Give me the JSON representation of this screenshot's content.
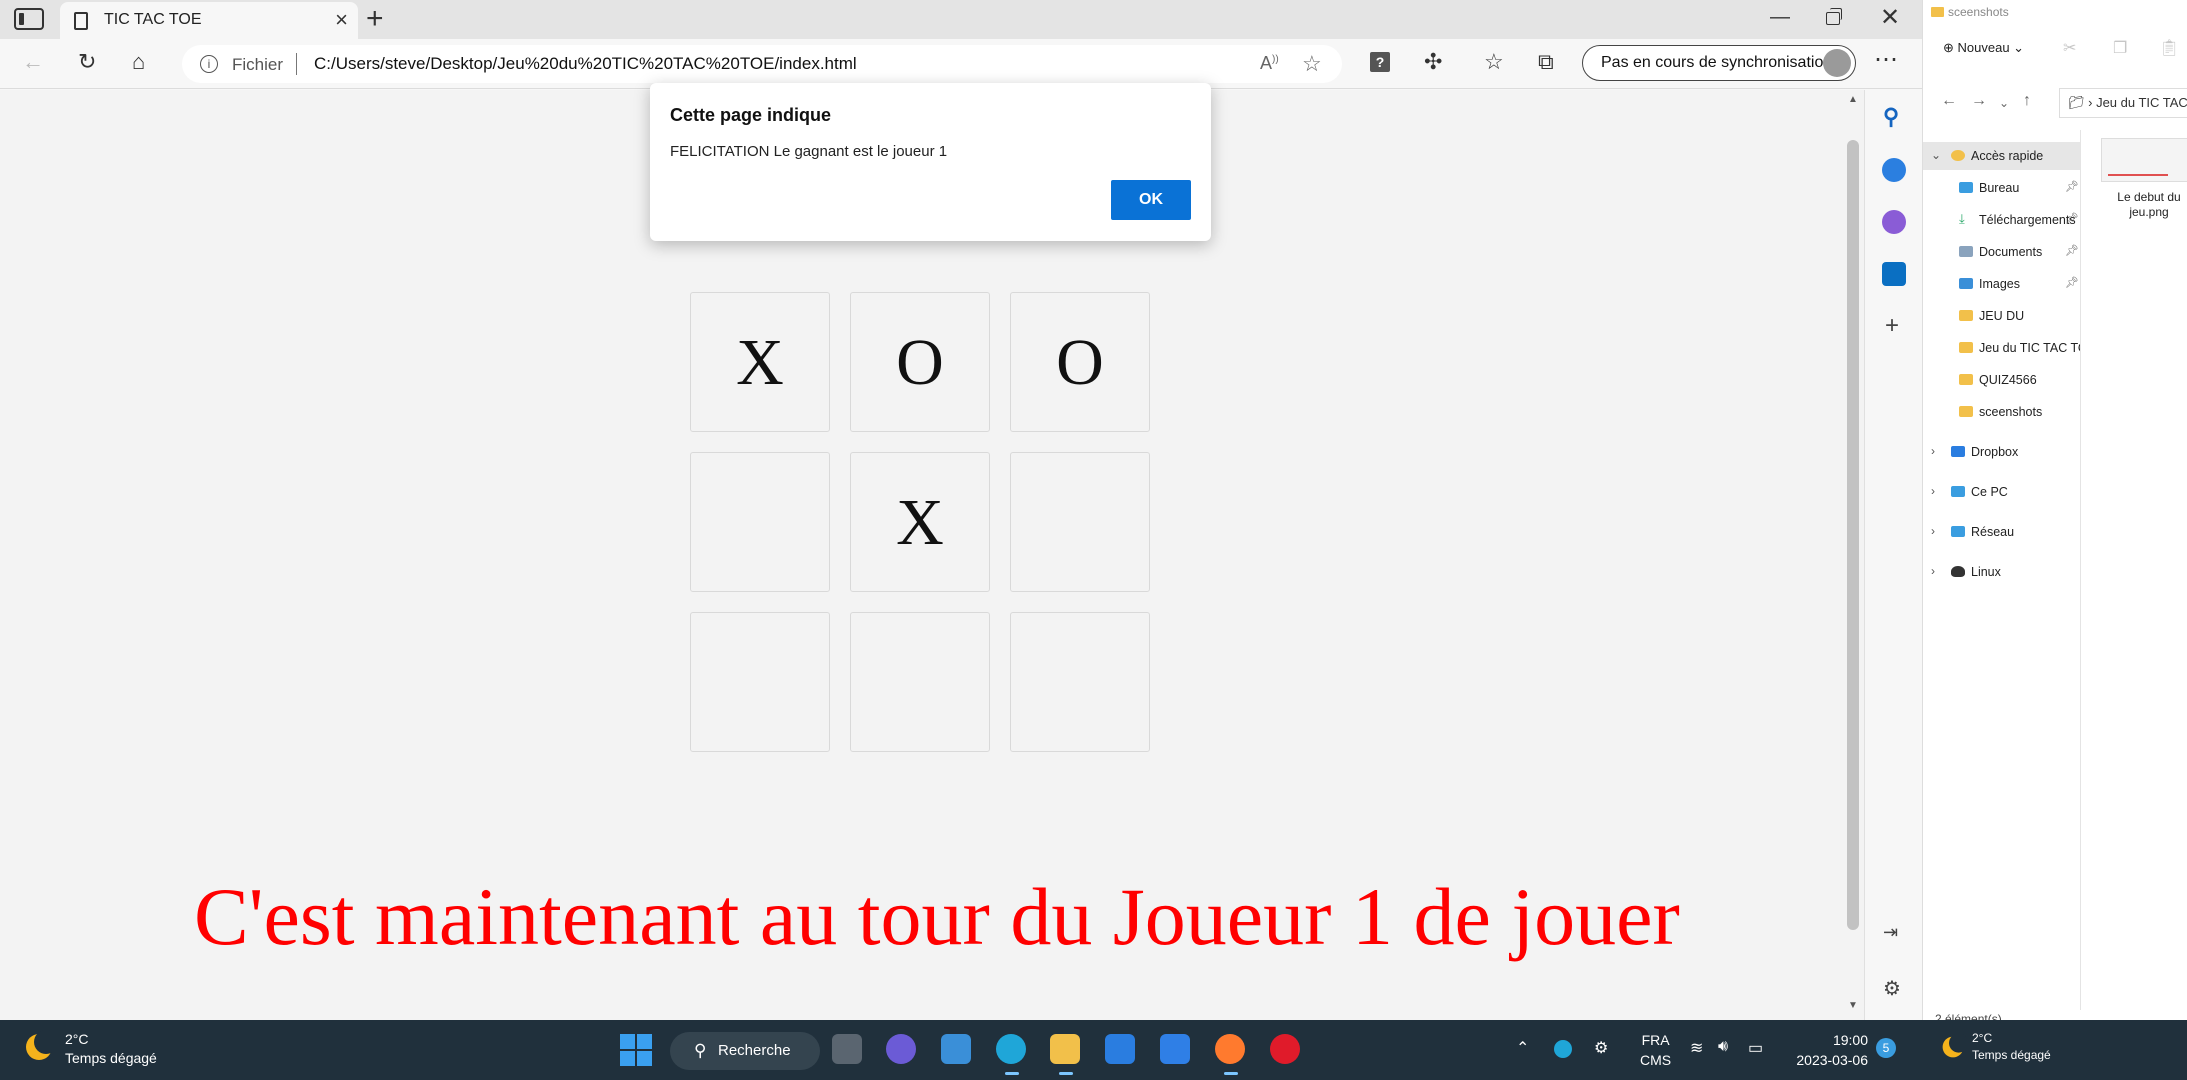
{
  "browser": {
    "tab_title": "TIC TAC TOE",
    "address_scheme": "Fichier",
    "address_url": "C:/Users/steve/Desktop/Jeu%20du%20TIC%20TAC%20TOE/index.html",
    "sync_label": "Pas en cours de synchronisation",
    "icons": [
      "tab-actions-icon",
      "page-icon",
      "close-icon",
      "new-tab-icon",
      "back-icon",
      "refresh-icon",
      "home-icon",
      "info-icon",
      "read-aloud-icon",
      "add-favorite-icon",
      "extension-icon",
      "favorites-icon",
      "collections-icon",
      "more-icon"
    ]
  },
  "dialog": {
    "title": "Cette page indique",
    "message": "FELICITATION Le gagnant est le joueur 1",
    "ok_label": "OK",
    "ok_color": "#0a72d6"
  },
  "game": {
    "board": [
      "X",
      "O",
      "O",
      "",
      "X",
      "",
      "",
      "",
      ""
    ],
    "status": "C'est maintenant au tour du Joueur 1 de jouer",
    "status_color": "#ff0000"
  },
  "explorer": {
    "window_title": "sceenshots",
    "new_label": "Nouveau",
    "breadcrumb": "Jeu du TIC TAC TOE",
    "tree": [
      {
        "label": "Accès rapide",
        "expandable": true,
        "selected": true,
        "pinned": false
      },
      {
        "label": "Bureau",
        "pinned": true
      },
      {
        "label": "Téléchargements",
        "pinned": true
      },
      {
        "label": "Documents",
        "pinned": true
      },
      {
        "label": "Images",
        "pinned": true
      },
      {
        "label": "JEU DU"
      },
      {
        "label": "Jeu du TIC TAC TOE"
      },
      {
        "label": "QUIZ4566"
      },
      {
        "label": "sceenshots"
      },
      {
        "label": "Dropbox",
        "expandable": true
      },
      {
        "label": "Ce PC",
        "expandable": true
      },
      {
        "label": "Réseau",
        "expandable": true
      },
      {
        "label": "Linux",
        "expandable": true
      }
    ],
    "file_name": "Le debut du jeu.png",
    "item_count": "2 élément(s)"
  },
  "taskbar": {
    "temperature": "2°C",
    "weather_desc": "Temps dégagé",
    "search_label": "Recherche",
    "lang_top": "FRA",
    "lang_bottom": "CMS",
    "time": "19:00",
    "date": "2023-03-06",
    "notif_count": "5",
    "right_temperature": "2°C",
    "right_weather_desc": "Temps dégagé"
  }
}
